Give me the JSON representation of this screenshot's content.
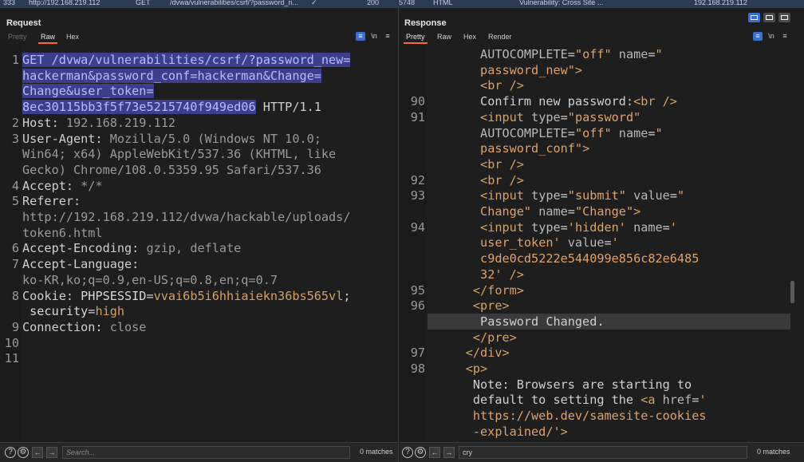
{
  "history": {
    "num": "333",
    "host": "http://192.168.219.112",
    "method": "GET",
    "url": "/dvwa/vulnerabilities/csrf/?password_n...",
    "check": "✓",
    "status": "200",
    "length": "5748",
    "mime": "HTML",
    "title": "Vulnerability: Cross Site ...",
    "ip": "192.168.219.112"
  },
  "request": {
    "title": "Request",
    "tabs": [
      "Pretty",
      "Raw",
      "Hex"
    ],
    "search_placeholder": "Search...",
    "matches": "0 matches",
    "gutter": [
      "1",
      "2",
      "3",
      "4",
      "5",
      "6",
      "7",
      "8",
      "9",
      "10",
      "11"
    ]
  },
  "response": {
    "title": "Response",
    "tabs": [
      "Pretty",
      "Raw",
      "Hex",
      "Render"
    ],
    "search_value": "cry",
    "matches": "0 matches",
    "gutter": [
      "90",
      "91",
      "92",
      "93",
      "94",
      "95",
      "96",
      "97",
      "98"
    ]
  },
  "req_lines": [
    {
      "n": "1",
      "p": [
        {
          "c": "sel",
          "t": "GET /dvwa/vulnerabilities/csrf/?password_new="
        }
      ]
    },
    {
      "p": [
        {
          "c": "sel",
          "t": "hackerman&password_conf=hackerman&Change="
        }
      ]
    },
    {
      "p": [
        {
          "c": "sel",
          "t": "Change&user_token="
        }
      ]
    },
    {
      "p": [
        {
          "c": "sel",
          "t": "8ec30115bb3f5f73e5215740f949ed06"
        },
        {
          "c": "plain",
          "t": " HTTP/1.1"
        }
      ]
    },
    {
      "n": "2",
      "p": [
        {
          "c": "hk",
          "t": "Host: "
        },
        {
          "c": "hv",
          "t": "192.168.219.112"
        }
      ]
    },
    {
      "n": "3",
      "p": [
        {
          "c": "hk",
          "t": "User-Agent: "
        },
        {
          "c": "hv",
          "t": "Mozilla/5.0 (Windows NT 10.0;"
        }
      ]
    },
    {
      "p": [
        {
          "c": "hv",
          "t": "Win64; x64) AppleWebKit/537.36 (KHTML, like"
        }
      ]
    },
    {
      "p": [
        {
          "c": "hv",
          "t": "Gecko) Chrome/108.0.5359.95 Safari/537.36"
        }
      ]
    },
    {
      "n": "4",
      "p": [
        {
          "c": "hk",
          "t": "Accept: "
        },
        {
          "c": "hv",
          "t": "*/*"
        }
      ]
    },
    {
      "n": "5",
      "p": [
        {
          "c": "hk",
          "t": "Referer:"
        }
      ]
    },
    {
      "p": [
        {
          "c": "hv",
          "t": "http://192.168.219.112/dvwa/hackable/uploads/"
        }
      ]
    },
    {
      "p": [
        {
          "c": "hv",
          "t": "token6.html"
        }
      ]
    },
    {
      "n": "6",
      "p": [
        {
          "c": "hk",
          "t": "Accept-Encoding: "
        },
        {
          "c": "hv",
          "t": "gzip, deflate"
        }
      ]
    },
    {
      "n": "7",
      "p": [
        {
          "c": "hk",
          "t": "Accept-Language:"
        }
      ]
    },
    {
      "p": [
        {
          "c": "hv",
          "t": "ko-KR,ko;q=0.9,en-US;q=0.8,en;q=0.7"
        }
      ]
    },
    {
      "n": "8",
      "p": [
        {
          "c": "hk",
          "t": "Cookie: "
        },
        {
          "c": "ckn",
          "t": "PHPSESSID"
        },
        {
          "c": "hk",
          "t": "="
        },
        {
          "c": "ckv",
          "t": "vvai6b5i6hhiaiekn36bs565vl"
        },
        {
          "c": "hk",
          "t": ";"
        }
      ]
    },
    {
      "p": [
        {
          "c": "ckn",
          "t": " security"
        },
        {
          "c": "hk",
          "t": "="
        },
        {
          "c": "ckv",
          "t": "high"
        }
      ]
    },
    {
      "n": "9",
      "p": [
        {
          "c": "hk",
          "t": "Connection: "
        },
        {
          "c": "hv",
          "t": "close"
        }
      ]
    },
    {
      "n": "10",
      "p": []
    },
    {
      "n": "11",
      "p": []
    }
  ],
  "resp_lines": [
    {
      "i": 7,
      "p": [
        {
          "c": "attr",
          "t": "AUTOCOMPLETE"
        },
        {
          "c": "txt",
          "t": "="
        },
        {
          "c": "str",
          "t": "\"off\""
        },
        {
          "c": "attr",
          "t": " name"
        },
        {
          "c": "txt",
          "t": "="
        },
        {
          "c": "str",
          "t": "\""
        }
      ]
    },
    {
      "i": 7,
      "p": [
        {
          "c": "str",
          "t": "password_new\""
        },
        {
          "c": "tag",
          "t": ">"
        }
      ]
    },
    {
      "i": 7,
      "p": [
        {
          "c": "tag",
          "t": "<br />"
        }
      ]
    },
    {
      "n": "90",
      "i": 7,
      "p": [
        {
          "c": "txt",
          "t": "Confirm new password:"
        },
        {
          "c": "tag",
          "t": "<br />"
        }
      ]
    },
    {
      "n": "91",
      "i": 7,
      "p": [
        {
          "c": "tag",
          "t": "<input"
        },
        {
          "c": "attr",
          "t": " type"
        },
        {
          "c": "txt",
          "t": "="
        },
        {
          "c": "str",
          "t": "\"password\""
        }
      ]
    },
    {
      "i": 7,
      "p": [
        {
          "c": "attr",
          "t": "AUTOCOMPLETE"
        },
        {
          "c": "txt",
          "t": "="
        },
        {
          "c": "str",
          "t": "\"off\""
        },
        {
          "c": "attr",
          "t": " name"
        },
        {
          "c": "txt",
          "t": "="
        },
        {
          "c": "str",
          "t": "\""
        }
      ]
    },
    {
      "i": 7,
      "p": [
        {
          "c": "str",
          "t": "password_conf\""
        },
        {
          "c": "tag",
          "t": ">"
        }
      ]
    },
    {
      "i": 7,
      "p": [
        {
          "c": "tag",
          "t": "<br />"
        }
      ]
    },
    {
      "n": "92",
      "i": 7,
      "p": [
        {
          "c": "tag",
          "t": "<br />"
        }
      ]
    },
    {
      "n": "93",
      "i": 7,
      "p": [
        {
          "c": "tag",
          "t": "<input"
        },
        {
          "c": "attr",
          "t": " type"
        },
        {
          "c": "txt",
          "t": "="
        },
        {
          "c": "str",
          "t": "\"submit\""
        },
        {
          "c": "attr",
          "t": " value"
        },
        {
          "c": "txt",
          "t": "="
        },
        {
          "c": "str",
          "t": "\""
        }
      ]
    },
    {
      "i": 7,
      "p": [
        {
          "c": "str",
          "t": "Change\""
        },
        {
          "c": "attr",
          "t": " name"
        },
        {
          "c": "txt",
          "t": "="
        },
        {
          "c": "str",
          "t": "\"Change\""
        },
        {
          "c": "tag",
          "t": ">"
        }
      ]
    },
    {
      "n": "94",
      "i": 7,
      "p": [
        {
          "c": "tag",
          "t": "<input"
        },
        {
          "c": "attr",
          "t": " type"
        },
        {
          "c": "txt",
          "t": "="
        },
        {
          "c": "str",
          "t": "'hidden'"
        },
        {
          "c": "attr",
          "t": " name"
        },
        {
          "c": "txt",
          "t": "="
        },
        {
          "c": "str",
          "t": "'"
        }
      ]
    },
    {
      "i": 7,
      "p": [
        {
          "c": "str",
          "t": "user_token'"
        },
        {
          "c": "attr",
          "t": " value"
        },
        {
          "c": "txt",
          "t": "="
        },
        {
          "c": "str",
          "t": "'"
        }
      ]
    },
    {
      "i": 7,
      "p": [
        {
          "c": "str",
          "t": "c9de0cd5222e544099e856c82e6485"
        }
      ]
    },
    {
      "i": 7,
      "p": [
        {
          "c": "str",
          "t": "32'"
        },
        {
          "c": "tag",
          "t": " />"
        }
      ]
    },
    {
      "n": "95",
      "i": 6,
      "p": [
        {
          "c": "tag",
          "t": "</form>"
        }
      ]
    },
    {
      "n": "96",
      "i": 6,
      "p": [
        {
          "c": "tag",
          "t": "<pre>"
        }
      ]
    },
    {
      "i": 7,
      "hl": true,
      "p": [
        {
          "c": "txt",
          "t": "Password Changed."
        }
      ]
    },
    {
      "i": 6,
      "p": [
        {
          "c": "tag",
          "t": "</pre>"
        }
      ]
    },
    {
      "n": "97",
      "i": 5,
      "p": [
        {
          "c": "tag",
          "t": "</div>"
        }
      ]
    },
    {
      "n": "98",
      "i": 5,
      "p": [
        {
          "c": "tag",
          "t": "<p>"
        }
      ]
    },
    {
      "i": 6,
      "p": [
        {
          "c": "txt",
          "t": "Note: Browsers are starting to"
        }
      ]
    },
    {
      "i": 6,
      "p": [
        {
          "c": "txt",
          "t": "default to setting the "
        },
        {
          "c": "tag",
          "t": "<a"
        },
        {
          "c": "attr",
          "t": " href"
        },
        {
          "c": "txt",
          "t": "="
        },
        {
          "c": "str",
          "t": "'"
        }
      ]
    },
    {
      "i": 6,
      "p": [
        {
          "c": "str",
          "t": "https://web.dev/samesite-cookies"
        }
      ]
    },
    {
      "i": 6,
      "p": [
        {
          "c": "str",
          "t": "-explained/'"
        },
        {
          "c": "tag",
          "t": ">"
        }
      ]
    }
  ]
}
